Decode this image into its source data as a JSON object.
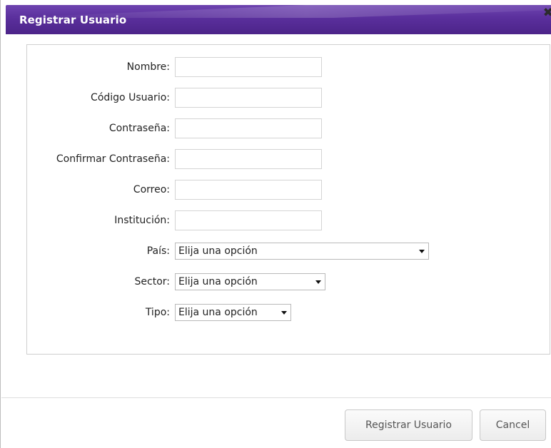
{
  "dialog": {
    "title": "Registrar Usuario",
    "close_icon": "close-icon"
  },
  "form": {
    "fields": [
      {
        "label": "Nombre:",
        "value": ""
      },
      {
        "label": "Código Usuario:",
        "value": ""
      },
      {
        "label": "Contraseña:",
        "value": ""
      },
      {
        "label": "Confirmar Contraseña:",
        "value": ""
      },
      {
        "label": "Correo:",
        "value": ""
      },
      {
        "label": "Institución:",
        "value": ""
      }
    ],
    "selects": [
      {
        "label": "País:",
        "selected": "Elija una opción"
      },
      {
        "label": "Sector:",
        "selected": "Elija una opción"
      },
      {
        "label": "Tipo:",
        "selected": "Elija una opción"
      }
    ]
  },
  "footer": {
    "register_label": "Registrar Usuario",
    "cancel_label": "Cancel"
  },
  "colors": {
    "titlebar": "#5a2f9c",
    "title_text": "#ffffff"
  }
}
